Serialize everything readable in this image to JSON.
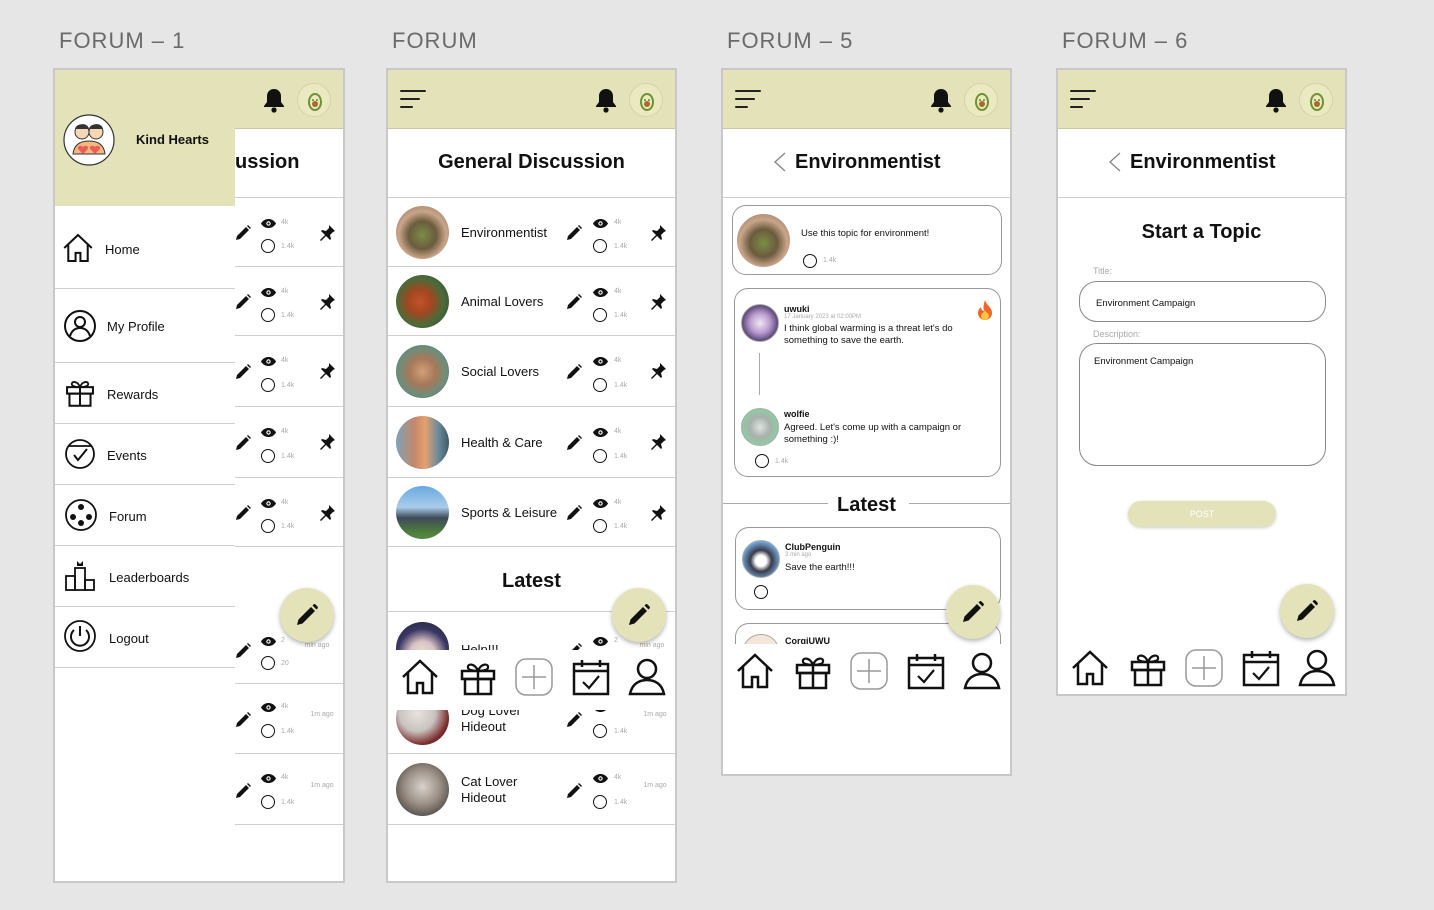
{
  "frames": {
    "f1": "FORUM – 1",
    "f2": "FORUM",
    "f3": "FORUM – 5",
    "f4": "FORUM – 6"
  },
  "colors": {
    "accent": "#e3e2b9",
    "background": "#e6e6e6",
    "fire": "#f0662a"
  },
  "forum1": {
    "partial_title": "ussion",
    "drawer": {
      "org_name": "Kind Hearts",
      "items": [
        {
          "label": "Home",
          "icon": "home-icon"
        },
        {
          "label": "My Profile",
          "icon": "user-circle-icon"
        },
        {
          "label": "Rewards",
          "icon": "gift-icon"
        },
        {
          "label": "Events",
          "icon": "calendar-check-icon"
        },
        {
          "label": "Forum",
          "icon": "forum-group-icon"
        },
        {
          "label": "Leaderboards",
          "icon": "podium-icon"
        },
        {
          "label": "Logout",
          "icon": "power-icon"
        }
      ]
    },
    "stats": {
      "views": "4k",
      "comments": "1.4k",
      "views2": "2",
      "comments2": "20",
      "time_partial": "min\nago"
    }
  },
  "forum": {
    "title": "General Discussion",
    "topics": [
      {
        "name": "Environmentist",
        "views": "4k",
        "comments": "1.4k"
      },
      {
        "name": "Animal Lovers",
        "views": "4k",
        "comments": "1.4k"
      },
      {
        "name": "Social Lovers",
        "views": "4k",
        "comments": "1.4k"
      },
      {
        "name": "Health & Care",
        "views": "4k",
        "comments": "1.4k"
      },
      {
        "name": "Sports & Leisure",
        "views": "4k",
        "comments": "1.4k"
      }
    ],
    "latest_label": "Latest",
    "latest": [
      {
        "name": "Help!!!",
        "views": "2",
        "comments": "20",
        "time": "min ago"
      },
      {
        "name_line1": "Dog Lover",
        "name_line2": "Hideout",
        "views": "4k",
        "comments": "1.4k",
        "time": "1m ago"
      },
      {
        "name_line1": "Cat Lover",
        "name_line2": "Hideout",
        "views": "4k",
        "comments": "1.4k",
        "time": "1m ago"
      }
    ]
  },
  "forum5": {
    "title": "Environmentist",
    "topic_desc": "Use this topic for environment!",
    "topic_comments": "1.4k",
    "thread": {
      "user1": "uwuki",
      "date1": "17 January 2023 at 02:00PM",
      "text1": "I think global warming is a threat let's do something to save the earth.",
      "user2": "wolfie",
      "text2": "Agreed. Let's come up with a campaign or something :)!",
      "comments": "1.4k"
    },
    "latest_label": "Latest",
    "latest_post": {
      "user": "ClubPenguin",
      "time": "3 min ago",
      "text": "Save the earth!!!"
    },
    "latest_post2_user": "CorgiUWU"
  },
  "forum6": {
    "title": "Environmentist",
    "heading": "Start a Topic",
    "title_label": "Title:",
    "title_value": "Environment Campaign",
    "desc_label": "Description:",
    "desc_value": "Environment Campaign",
    "post_button": "POST"
  }
}
